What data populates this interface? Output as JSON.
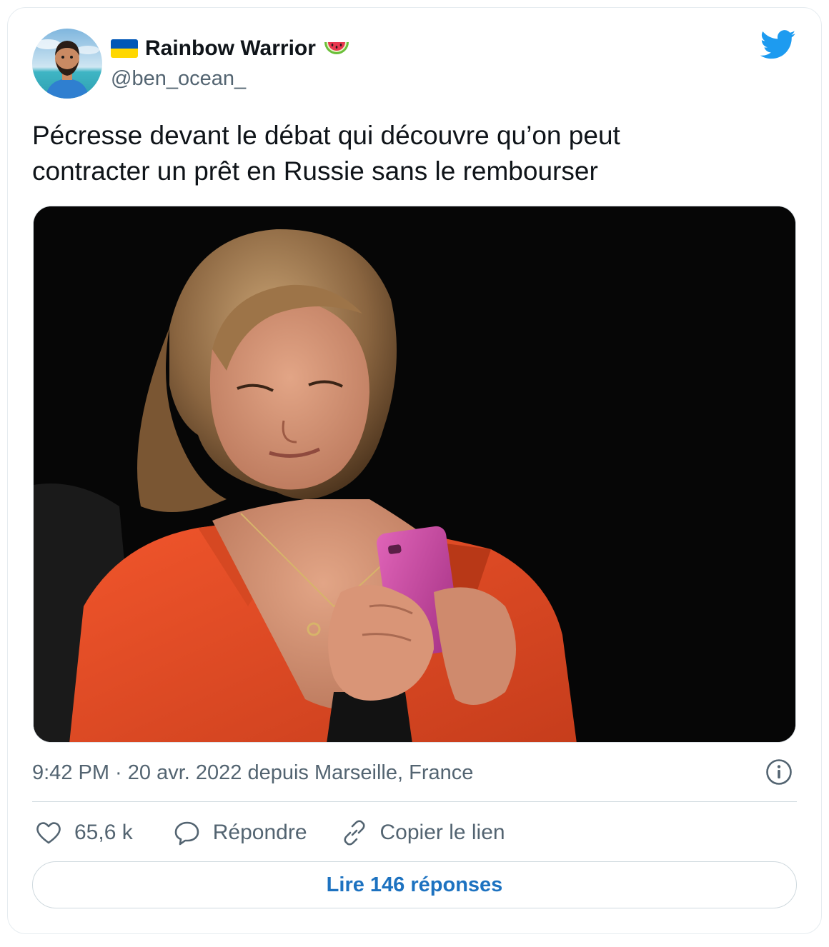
{
  "author": {
    "name": "Rainbow Warrior",
    "handle": "@ben_ocean_",
    "flag_icon": "ukraine-flag-icon",
    "emoji_icon": "watermelon-icon"
  },
  "tweet": {
    "text_line1": "Pécresse devant le débat qui découvre qu’on peut",
    "text_line2": "contracter un prêt en Russie sans le rembourser",
    "timestamp": "9:42 PM · 20 avr. 2022 depuis Marseille, France"
  },
  "actions": {
    "likes": "65,6 k",
    "reply_label": "Répondre",
    "copy_label": "Copier le lien"
  },
  "read_replies": "Lire 146 réponses",
  "colors": {
    "twitter_blue": "#1d9bf0",
    "link_blue": "#1d72c0",
    "secondary_text": "#536471"
  }
}
